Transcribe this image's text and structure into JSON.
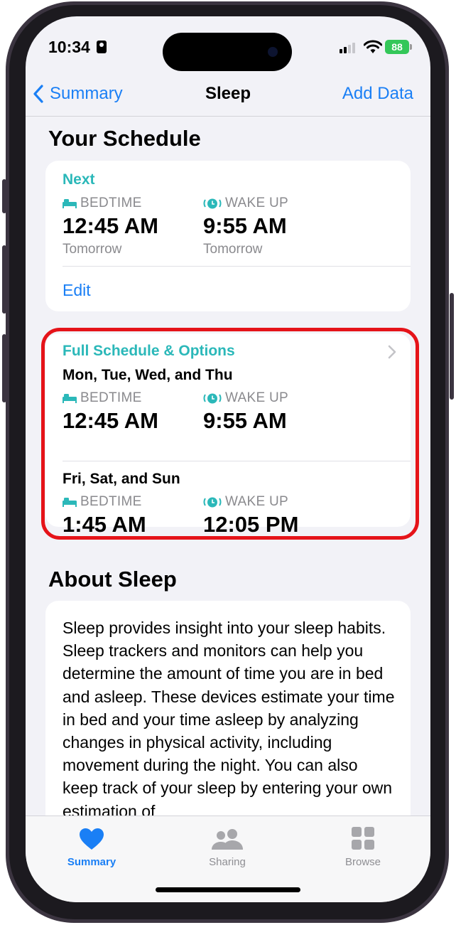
{
  "status_bar": {
    "time": "10:34",
    "battery": "88"
  },
  "nav": {
    "back_label": "Summary",
    "title": "Sleep",
    "action_label": "Add Data"
  },
  "schedule": {
    "title": "Your Schedule",
    "next": {
      "label": "Next",
      "bedtime_caption": "BEDTIME",
      "bedtime": "12:45 AM",
      "bedtime_day": "Tomorrow",
      "wakeup_caption": "WAKE UP",
      "wakeup": "9:55 AM",
      "wakeup_day": "Tomorrow",
      "edit_label": "Edit"
    },
    "full": {
      "label": "Full Schedule & Options",
      "groups": [
        {
          "days": "Mon, Tue, Wed, and Thu",
          "bedtime_caption": "BEDTIME",
          "bedtime": "12:45 AM",
          "wakeup_caption": "WAKE UP",
          "wakeup": "9:55 AM"
        },
        {
          "days": "Fri, Sat, and Sun",
          "bedtime_caption": "BEDTIME",
          "bedtime": "1:45 AM",
          "wakeup_caption": "WAKE UP",
          "wakeup": "12:05 PM"
        }
      ]
    }
  },
  "about": {
    "title": "About Sleep",
    "text": "Sleep provides insight into your sleep habits. Sleep trackers and monitors can help you determine the amount of time you are in bed and asleep. These devices estimate your time in bed and your time asleep by analyzing changes in physical activity, including movement during the night. You can also keep track of your sleep by entering your own estimation of"
  },
  "tabs": [
    {
      "label": "Summary",
      "icon": "heart-icon",
      "active": true
    },
    {
      "label": "Sharing",
      "icon": "people-icon",
      "active": false
    },
    {
      "label": "Browse",
      "icon": "grid-icon",
      "active": false
    }
  ],
  "colors": {
    "accent": "#1a7ff5",
    "teal": "#2bb8b9",
    "highlight": "#e51319",
    "battery": "#34c759"
  }
}
